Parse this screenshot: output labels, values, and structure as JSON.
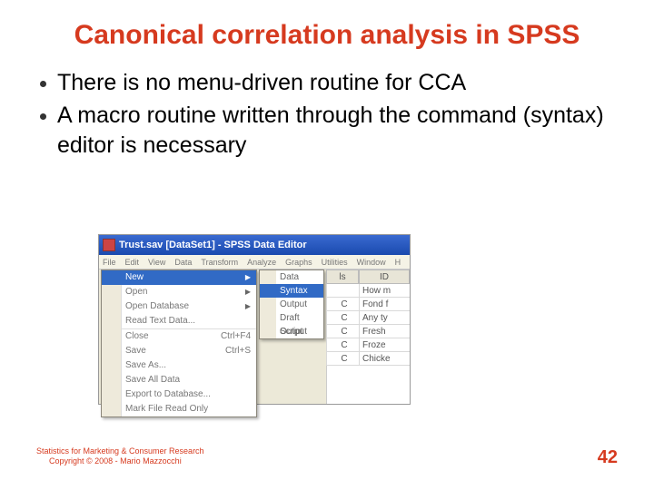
{
  "title": "Canonical correlation analysis in SPSS",
  "bullets": [
    "There is no menu-driven routine for CCA",
    "A macro routine written through the command (syntax) editor is necessary"
  ],
  "spss": {
    "window_title": "Trust.sav [DataSet1] - SPSS Data Editor",
    "menubar": [
      "File",
      "Edit",
      "View",
      "Data",
      "Transform",
      "Analyze",
      "Graphs",
      "Utilities",
      "Window",
      "H"
    ],
    "file_menu": {
      "new": "New",
      "open": "Open",
      "open_db": "Open Database",
      "read_text": "Read Text Data...",
      "close": "Close",
      "close_shortcut": "Ctrl+F4",
      "save": "Save",
      "save_shortcut": "Ctrl+S",
      "save_as": "Save As...",
      "save_all": "Save All Data",
      "export_db": "Export to Database...",
      "mark_ro": "Mark File Read Only"
    },
    "new_submenu": {
      "data": "Data",
      "syntax": "Syntax",
      "output": "Output",
      "draft": "Draft Output",
      "script": "Script"
    },
    "sheet": {
      "left_header": "ls",
      "right_header": "ID",
      "left_cells": [
        "",
        "C",
        "C",
        "C",
        "C",
        "C"
      ],
      "right_cells": [
        "How m",
        "Fond f",
        "Any ty",
        "Fresh",
        "Froze",
        "Chicke"
      ]
    }
  },
  "footer": {
    "line1": "Statistics for Marketing & Consumer Research",
    "line2": "Copyright © 2008 - Mario Mazzocchi",
    "page": "42"
  }
}
